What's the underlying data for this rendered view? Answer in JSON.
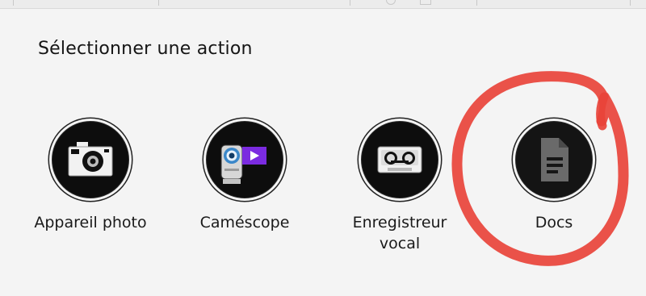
{
  "dialog": {
    "title": "Sélectionner une action"
  },
  "actions": [
    {
      "label": "Appareil photo",
      "icon": "camera-icon"
    },
    {
      "label": "Caméscope",
      "icon": "camcorder-icon"
    },
    {
      "label": "Enregistreur\nvocal",
      "icon": "voice-recorder-icon"
    },
    {
      "label": "Docs",
      "icon": "document-icon"
    }
  ],
  "colors": {
    "annotation": "#e8433a",
    "icon_bg": "#0d0d0d",
    "camcorder_accent": "#7b2be0"
  }
}
